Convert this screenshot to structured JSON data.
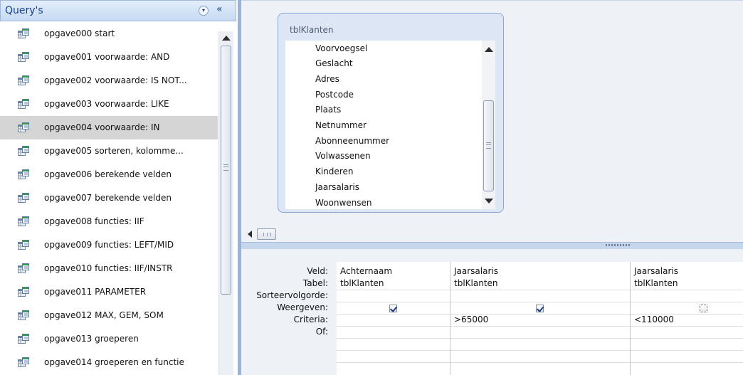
{
  "nav": {
    "title": "Query's",
    "dropdown_icon": "▾",
    "collapse_icon": "«",
    "items": [
      {
        "label": "opgave000 start"
      },
      {
        "label": "opgave001 voorwaarde: AND"
      },
      {
        "label": "opgave002 voorwaarde: IS NOT..."
      },
      {
        "label": "opgave003 voorwaarde: LIKE"
      },
      {
        "label": "opgave004 voorwaarde: IN",
        "selected": true
      },
      {
        "label": "opgave005 sorteren, kolomme..."
      },
      {
        "label": "opgave006 berekende velden"
      },
      {
        "label": "opgave007 berekende velden"
      },
      {
        "label": "opgave008 functies: IIF"
      },
      {
        "label": "opgave009 functies: LEFT/MID"
      },
      {
        "label": "opgave010 functies: IIF/INSTR"
      },
      {
        "label": "opgave011 PARAMETER"
      },
      {
        "label": "opgave012 MAX, GEM, SOM"
      },
      {
        "label": "opgave013 groeperen"
      },
      {
        "label": "opgave014 groeperen en functie"
      }
    ]
  },
  "table_box": {
    "title": "tblKlanten",
    "fields": [
      "Voorvoegsel",
      "Geslacht",
      "Adres",
      "Postcode",
      "Plaats",
      "Netnummer",
      "Abonneenummer",
      "Volwassenen",
      "Kinderen",
      "Jaarsalaris",
      "Woonwensen"
    ]
  },
  "grid": {
    "row_labels": [
      "Veld:",
      "Tabel:",
      "Sorteervolgorde:",
      "Weergeven:",
      "Criteria:",
      "Of:"
    ],
    "columns": [
      {
        "veld": "Achternaam",
        "tabel": "tblKlanten",
        "sort": "",
        "weergeven": true,
        "criteria": "",
        "of": ""
      },
      {
        "veld": "Jaarsalaris",
        "tabel": "tblKlanten",
        "sort": "",
        "weergeven": true,
        "criteria": ">65000",
        "of": ""
      },
      {
        "veld": "Jaarsalaris",
        "tabel": "tblKlanten",
        "sort": "",
        "weergeven": false,
        "criteria": "<110000",
        "of": ""
      }
    ]
  },
  "colors": {
    "nav_header": "#c7daf2",
    "selected_row": "#d5d5d5",
    "design_bg": "#eef1f5",
    "table_box_bg": "#dce6f4"
  }
}
